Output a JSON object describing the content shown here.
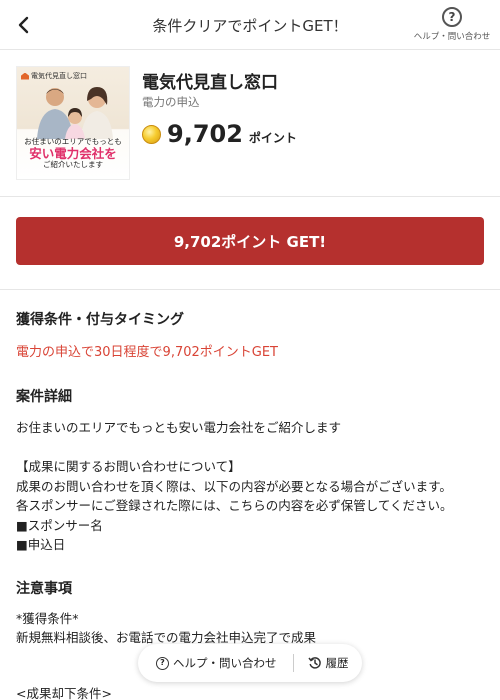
{
  "header": {
    "title": "条件クリアでポイントGET！",
    "help_label": "ヘルプ・問い合わせ"
  },
  "product": {
    "thumbnail": {
      "brand": "電気代見直し窓口",
      "line1": "お住まいのエリアでもっとも",
      "line2": "安い電力会社を",
      "line3": "ご紹介いたします"
    },
    "title": "電気代見直し窓口",
    "subtitle": "電力の申込",
    "points_value": "9,702",
    "points_unit": "ポイント"
  },
  "cta": {
    "label": "9,702ポイント GET!"
  },
  "conditions": {
    "heading": "獲得条件・付与タイミング",
    "text": "電力の申込で30日程度で9,702ポイントGET"
  },
  "details": {
    "heading": "案件詳細",
    "intro": "お住まいのエリアでもっとも安い電力会社をご紹介します",
    "lines": [
      "【成果に関するお問い合わせについて】",
      "成果のお問い合わせを頂く際は、以下の内容が必要となる場合がございます。",
      "各スポンサーにご登録された際には、こちらの内容を必ず保管してください。",
      "■スポンサー名",
      "■申込日"
    ]
  },
  "notes": {
    "heading": "注意事項",
    "lines": [
      "*獲得条件*",
      "新規無料相談後、お電話での電力会社申込完了で成果"
    ],
    "rejection_heading": "<成果却下条件>"
  },
  "floating_bar": {
    "help_label": "ヘルプ・問い合わせ",
    "history_label": "履歴"
  },
  "colors": {
    "accent_red": "#b5302e",
    "condition_red": "#d94436",
    "thumbnail_pink": "#e0306a",
    "coin_gold": "#f6cc2f"
  },
  "icons": {
    "back": "chevron-left-icon",
    "help": "question-circle-icon",
    "coin": "coin-icon",
    "history": "clock-history-icon"
  }
}
